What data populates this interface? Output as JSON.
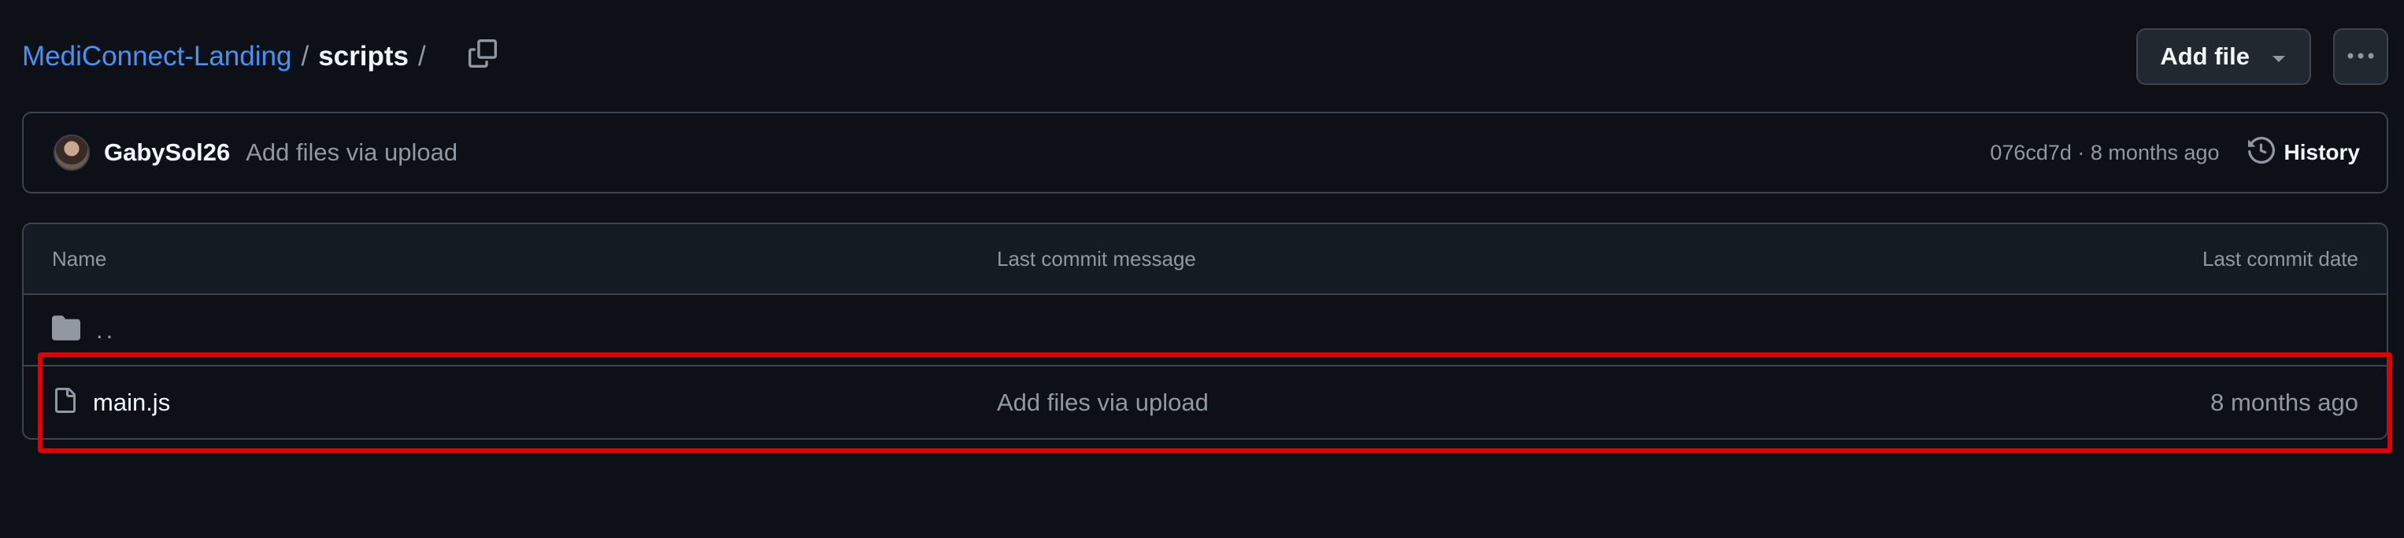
{
  "breadcrumb": {
    "repo": "MediConnect-Landing",
    "separator": "/",
    "directory": "scripts",
    "trailing_separator": "/"
  },
  "header": {
    "add_file_label": "Add file"
  },
  "commit": {
    "author": "GabySol26",
    "message": "Add files via upload",
    "meta": "076cd7d · 8 months ago",
    "history_label": "History"
  },
  "table": {
    "columns": [
      "Name",
      "Last commit message",
      "Last commit date"
    ],
    "parent_label": "..",
    "rows": [
      {
        "name": "main.js",
        "message": "Add files via upload",
        "date": "8 months ago"
      }
    ]
  },
  "colors": {
    "background": "#0d1117",
    "link": "#4493f8",
    "border": "#3d444d",
    "highlight": "#e00000"
  },
  "icons": [
    "copy-icon",
    "triangle-down-icon",
    "kebab-horizontal-icon",
    "history-icon",
    "folder-icon",
    "file-icon"
  ]
}
